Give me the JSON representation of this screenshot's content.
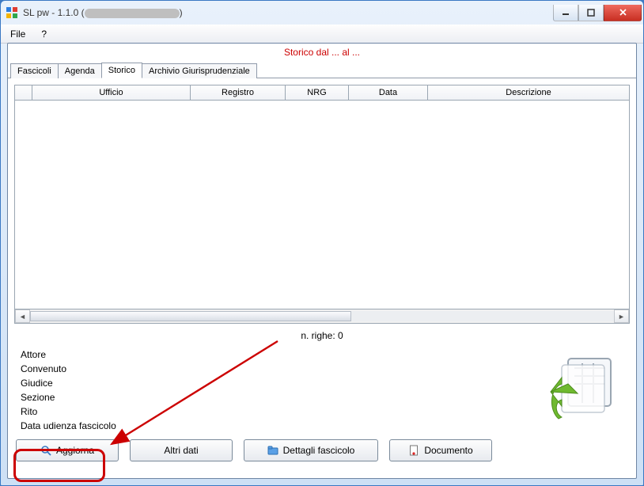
{
  "window": {
    "title_prefix": "SL pw - 1.1.0 (",
    "title_suffix": ")"
  },
  "menu": {
    "file": "File",
    "help": "?"
  },
  "status_text": "Storico dal ... al ...",
  "tabs": {
    "fascicoli": "Fascicoli",
    "agenda": "Agenda",
    "storico": "Storico",
    "archivio": "Archivio Giurisprudenziale"
  },
  "columns": {
    "ufficio": "Ufficio",
    "registro": "Registro",
    "nrg": "NRG",
    "data": "Data",
    "descrizione": "Descrizione"
  },
  "rows": [],
  "rowcount_label": "n. righe: 0",
  "details": {
    "attore": "Attore",
    "convenuto": "Convenuto",
    "giudice": "Giudice",
    "sezione": "Sezione",
    "rito": "Rito",
    "data_udienza": "Data udienza fascicolo"
  },
  "buttons": {
    "aggiorna": "Aggiorna",
    "altri_dati": "Altri dati",
    "dettagli": "Dettagli fascicolo",
    "documento": "Documento"
  }
}
